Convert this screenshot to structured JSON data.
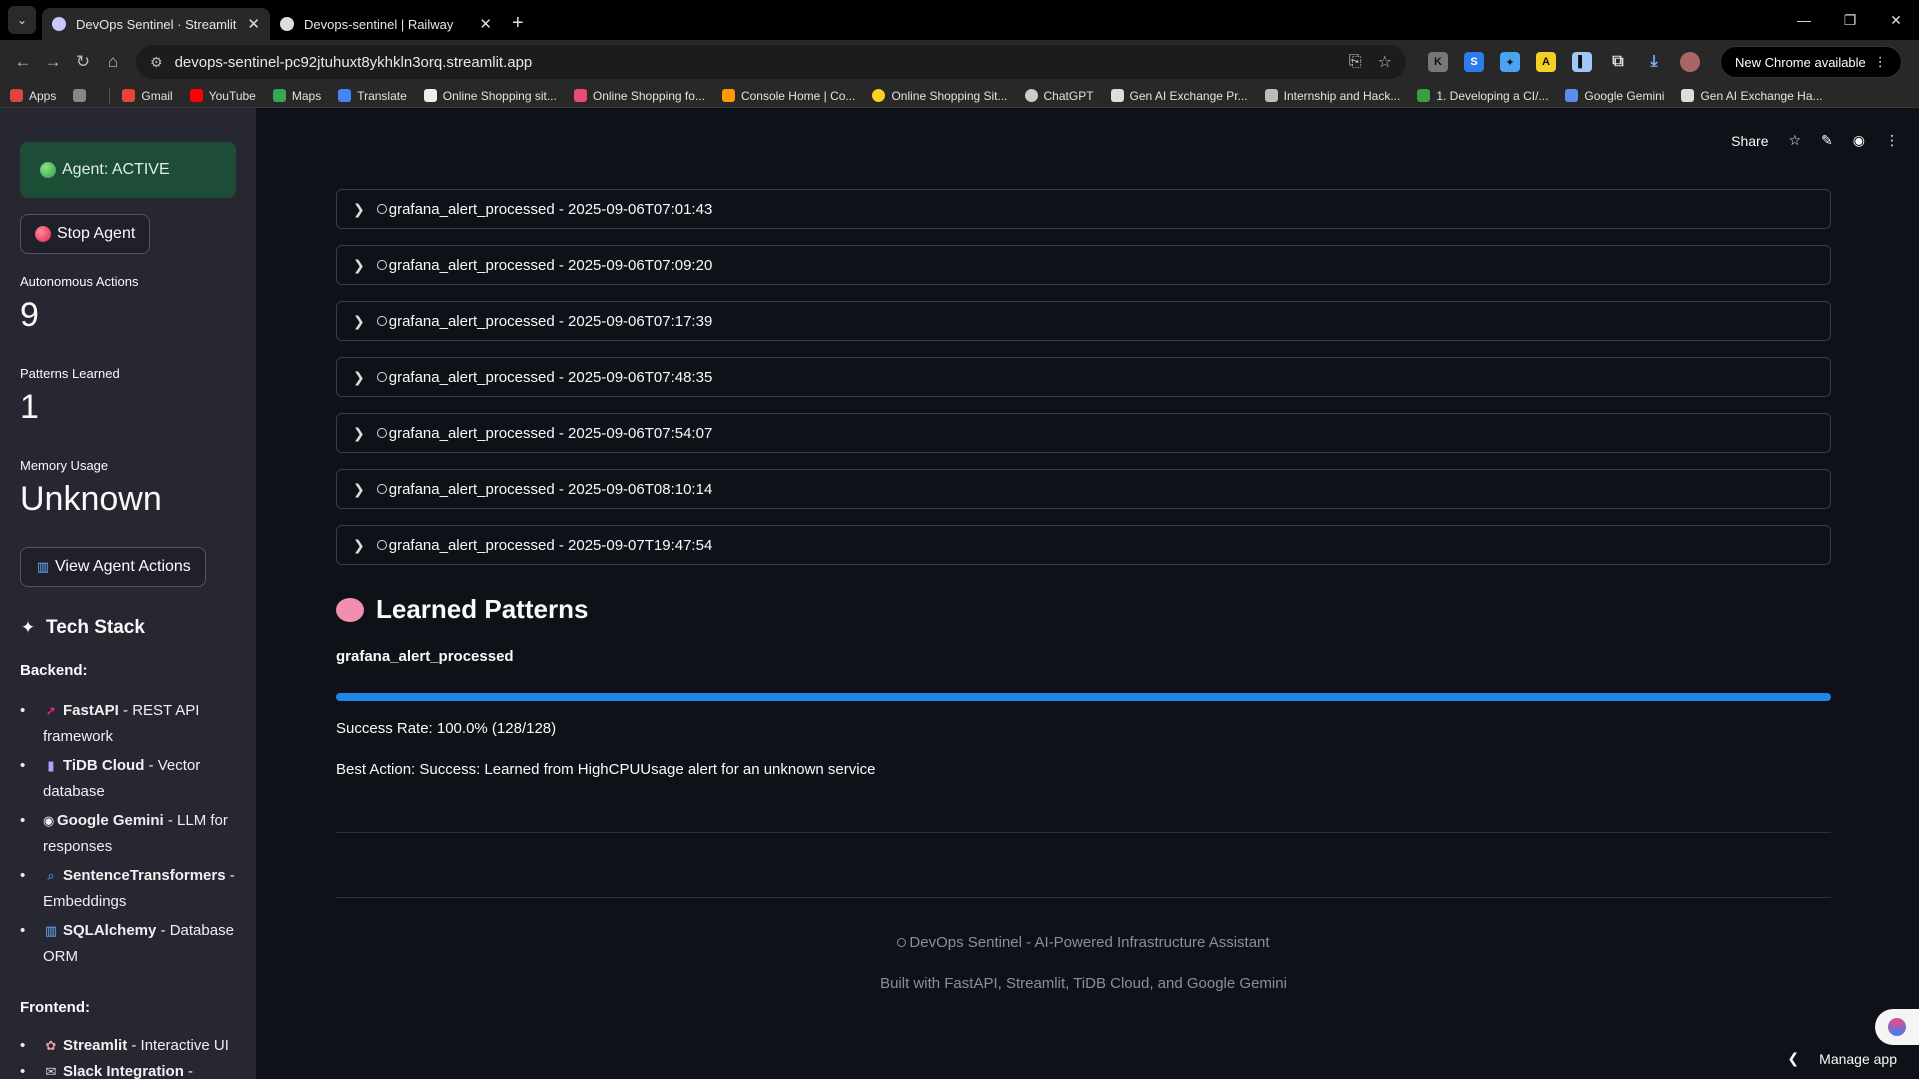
{
  "browser": {
    "tabs": [
      {
        "title": "DevOps Sentinel · Streamlit",
        "active": true
      },
      {
        "title": "Devops-sentinel | Railway",
        "active": false
      }
    ],
    "url": "devops-sentinel-pc92jtuhuxt8ykhkln3orq.streamlit.app",
    "new_chrome": "New Chrome available",
    "bookmarks": [
      "Apps",
      "Gmail",
      "YouTube",
      "Maps",
      "Translate",
      "Online Shopping sit...",
      "Online Shopping fo...",
      "Console Home | Co...",
      "Online Shopping Sit...",
      "ChatGPT",
      "Gen AI Exchange Pr...",
      "Internship and Hack...",
      "1. Developing a CI/...",
      "Google Gemini",
      "Gen AI Exchange Ha..."
    ]
  },
  "sidebar": {
    "agent_status": "Agent: ACTIVE",
    "stop_button": "Stop Agent",
    "metrics": [
      {
        "label": "Autonomous Actions",
        "value": "9"
      },
      {
        "label": "Patterns Learned",
        "value": "1"
      },
      {
        "label": "Memory Usage",
        "value": "Unknown"
      }
    ],
    "view_actions_button": "View Agent Actions",
    "tech_stack_title": "Tech Stack",
    "backend_label": "Backend:",
    "backend": [
      {
        "name": "FastAPI",
        "desc": " - REST API framework"
      },
      {
        "name": "TiDB Cloud",
        "desc": " - Vector database"
      },
      {
        "name": "Google Gemini",
        "desc": " - LLM for responses"
      },
      {
        "name": "SentenceTransformers",
        "desc": " - Embeddings"
      },
      {
        "name": "SQLAlchemy",
        "desc": " - Database ORM"
      }
    ],
    "frontend_label": "Frontend:",
    "frontend": [
      {
        "name": "Streamlit",
        "desc": " - Interactive UI"
      },
      {
        "name": "Slack Integration",
        "desc": " -"
      }
    ]
  },
  "header": {
    "share": "Share"
  },
  "events": [
    "grafana_alert_processed - 2025-09-06T07:01:43",
    "grafana_alert_processed - 2025-09-06T07:09:20",
    "grafana_alert_processed - 2025-09-06T07:17:39",
    "grafana_alert_processed - 2025-09-06T07:48:35",
    "grafana_alert_processed - 2025-09-06T07:54:07",
    "grafana_alert_processed - 2025-09-06T08:10:14",
    "grafana_alert_processed - 2025-09-07T19:47:54"
  ],
  "learned_patterns": {
    "title": "Learned Patterns",
    "pattern_name": "grafana_alert_processed",
    "progress_fraction": 1.0,
    "success_rate": "Success Rate: 100.0% (128/128)",
    "best_action": "Best Action: Success: Learned from HighCPUUsage alert for an unknown service"
  },
  "footer": {
    "line1": "DevOps Sentinel - AI-Powered Infrastructure Assistant",
    "line2": "Built with FastAPI, Streamlit, TiDB Cloud, and Google Gemini"
  },
  "manage_app": "Manage app",
  "colors": {
    "accent": "#1f86e5",
    "sidebar_bg": "#262730",
    "main_bg": "#0e1117",
    "status_bg": "#1d4d37"
  }
}
